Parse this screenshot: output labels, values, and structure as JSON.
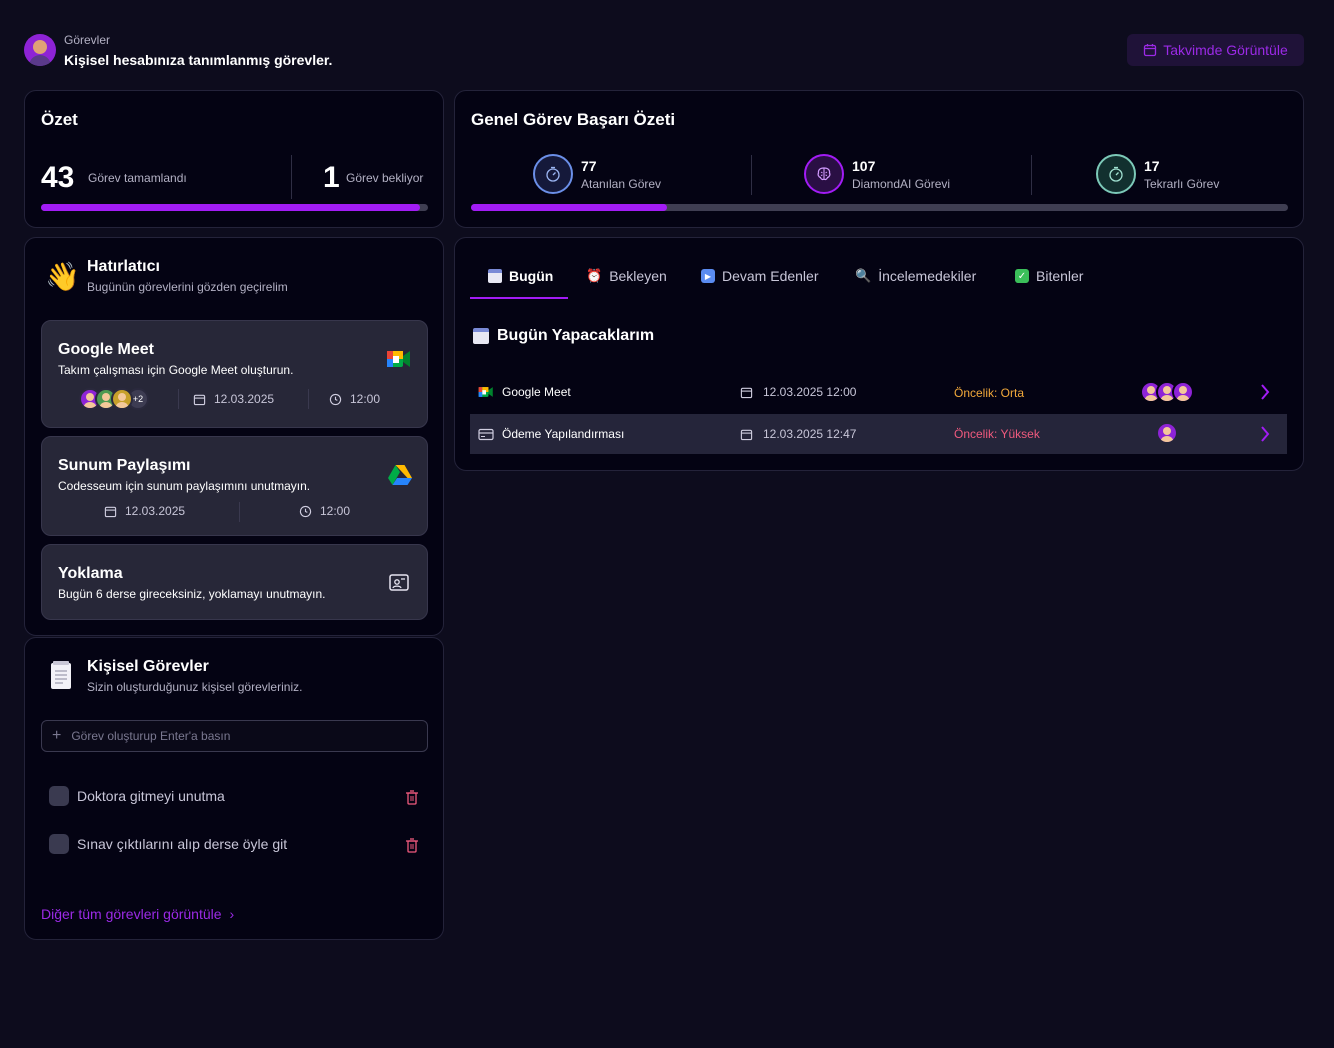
{
  "header": {
    "section": "Görevler",
    "subtitle": "Kişisel hesabınıza tanımlanmış görevler.",
    "calendar_button": "Takvimde Görüntüle"
  },
  "summary": {
    "title": "Özet",
    "completed_count": "43",
    "completed_label": "Görev tamamlandı",
    "pending_count": "1",
    "pending_label": "Görev bekliyor",
    "progress": 0.98
  },
  "success": {
    "title": "Genel Görev Başarı Özeti",
    "stats": [
      {
        "value": "77",
        "label": "Atanılan Görev",
        "icon": "stopwatch-icon",
        "color": "#6b8fe8"
      },
      {
        "value": "107",
        "label": "DiamondAI Görevi",
        "icon": "brain-icon",
        "color": "#b32bff"
      },
      {
        "value": "17",
        "label": "Tekrarlı Görev",
        "icon": "stopwatch-icon",
        "color": "#7cc9b8"
      }
    ],
    "progress": 0.24
  },
  "reminder": {
    "title": "Hatırlatıcı",
    "subtitle": "Bugünün görevlerini gözden geçirelim",
    "items": [
      {
        "title": "Google Meet",
        "desc": "Takım çalışması için Google Meet oluşturun.",
        "extra": "+2",
        "date": "12.03.2025",
        "time": "12:00"
      },
      {
        "title": "Sunum Paylaşımı",
        "desc": "Codesseum için sunum paylaşımını unutmayın.",
        "date": "12.03.2025",
        "time": "12:00"
      },
      {
        "title": "Yoklama",
        "desc": "Bugün 6 derse gireceksiniz, yoklamayı unutmayın."
      }
    ]
  },
  "personal": {
    "title": "Kişisel Görevler",
    "subtitle": "Sizin oluşturduğunuz kişisel görevleriniz.",
    "input_placeholder": "Görev oluşturup Enter'a basın",
    "tasks": [
      "Doktora gitmeyi unutma",
      "Sınav çıktılarını alıp derse öyle git"
    ],
    "view_all": "Diğer tüm görevleri görüntüle"
  },
  "tabs": [
    "Bugün",
    "Bekleyen",
    "Devam Edenler",
    "İncelemedekiler",
    "Bitenler"
  ],
  "today": {
    "title": "Bugün Yapacaklarım",
    "rows": [
      {
        "name": "Google Meet",
        "datetime": "12.03.2025 12:00",
        "priority": "Öncelik: Orta",
        "priority_color": "#f2a93b"
      },
      {
        "name": "Ödeme Yapılandırması",
        "datetime": "12.03.2025 12:47",
        "priority": "Öncelik: Yüksek",
        "priority_color": "#f05a7e"
      }
    ]
  },
  "colors": {
    "accent": "#a21cf5",
    "background": "#0d0c1d",
    "card": "#040313"
  }
}
